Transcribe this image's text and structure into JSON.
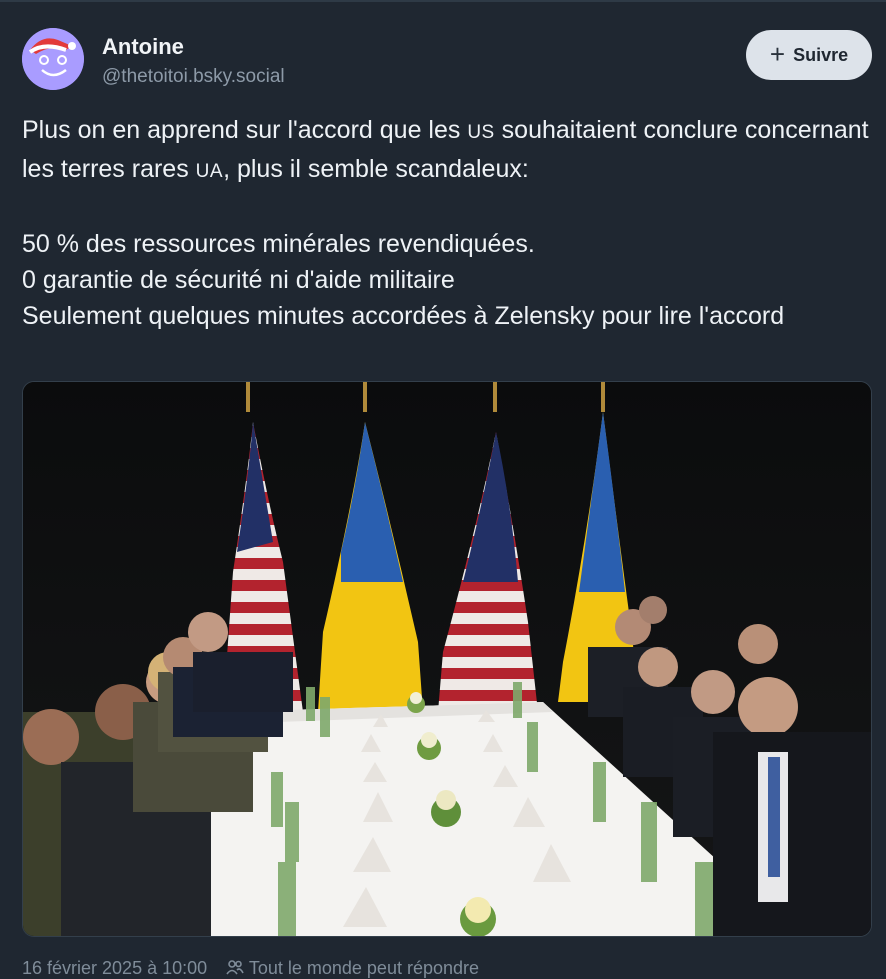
{
  "author": {
    "display_name": "Antoine",
    "handle": "@thetoitoi.bsky.social",
    "avatar_icon": "avatar-icon"
  },
  "follow_button": {
    "icon": "plus-icon",
    "label": "Suivre"
  },
  "post": {
    "line1_a": "Plus on en apprend sur l'accord que les ",
    "line1_us": "US",
    "line1_b": " souhaitaient conclure concernant les terres rares ",
    "line1_ua": "UA",
    "line1_c": ", plus il semble scandaleux:",
    "line2": "50 % des ressources minérales revendiquées.",
    "line3": "0 garantie de sécurité ni d'aide militaire",
    "line4": "Seulement quelques minutes accordées à Zelensky pour lire l'accord"
  },
  "footer": {
    "date": "16 février 2025 à 10:00",
    "reply_icon": "people-icon",
    "reply_setting": "Tout le monde peut répondre"
  },
  "colors": {
    "background": "#1f2731",
    "text": "#eef2f6",
    "muted": "#8d9aa8",
    "button_bg": "#dde3ea"
  }
}
